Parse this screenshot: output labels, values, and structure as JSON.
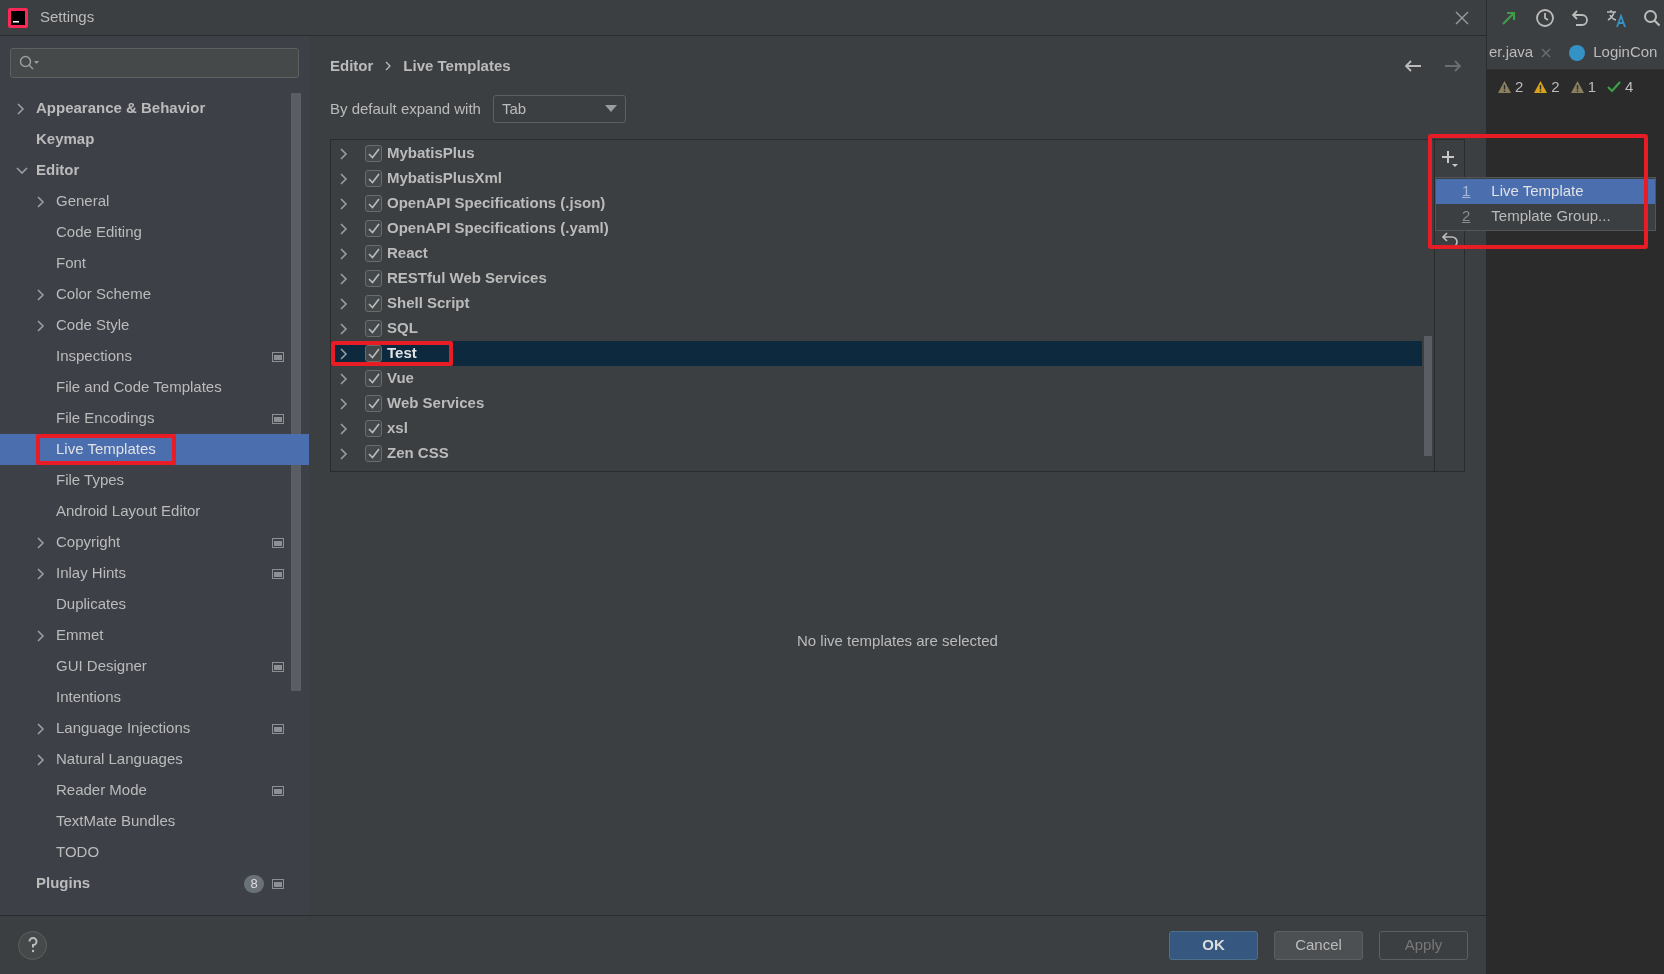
{
  "window": {
    "title": "Settings"
  },
  "sidebar": {
    "items": [
      {
        "label": "Appearance & Behavior",
        "expandable": true,
        "expanded": false,
        "selected": false,
        "highlighted": false,
        "project_level": false
      },
      {
        "label": "Keymap",
        "expandable": false,
        "selected": false,
        "highlighted": false,
        "project_level": false
      },
      {
        "label": "Editor",
        "expandable": true,
        "expanded": true,
        "selected": false,
        "highlighted": false,
        "project_level": false,
        "children": [
          {
            "label": "General",
            "expandable": true,
            "expanded": false,
            "selected": false,
            "highlighted": false,
            "project_level": false
          },
          {
            "label": "Code Editing",
            "expandable": false,
            "selected": false,
            "highlighted": false,
            "project_level": false
          },
          {
            "label": "Font",
            "expandable": false,
            "selected": false,
            "highlighted": false,
            "project_level": false
          },
          {
            "label": "Color Scheme",
            "expandable": true,
            "expanded": false,
            "selected": false,
            "highlighted": false,
            "project_level": false
          },
          {
            "label": "Code Style",
            "expandable": true,
            "expanded": false,
            "selected": false,
            "highlighted": false,
            "project_level": false
          },
          {
            "label": "Inspections",
            "expandable": false,
            "selected": false,
            "highlighted": false,
            "project_level": true
          },
          {
            "label": "File and Code Templates",
            "expandable": false,
            "selected": false,
            "highlighted": false,
            "project_level": false
          },
          {
            "label": "File Encodings",
            "expandable": false,
            "selected": false,
            "highlighted": false,
            "project_level": true
          },
          {
            "label": "Live Templates",
            "expandable": false,
            "selected": true,
            "highlighted": true,
            "project_level": false
          },
          {
            "label": "File Types",
            "expandable": false,
            "selected": false,
            "highlighted": false,
            "project_level": false
          },
          {
            "label": "Android Layout Editor",
            "expandable": false,
            "selected": false,
            "highlighted": false,
            "project_level": false
          },
          {
            "label": "Copyright",
            "expandable": true,
            "expanded": false,
            "selected": false,
            "highlighted": false,
            "project_level": true
          },
          {
            "label": "Inlay Hints",
            "expandable": true,
            "expanded": false,
            "selected": false,
            "highlighted": false,
            "project_level": true
          },
          {
            "label": "Duplicates",
            "expandable": false,
            "selected": false,
            "highlighted": false,
            "project_level": false
          },
          {
            "label": "Emmet",
            "expandable": true,
            "expanded": false,
            "selected": false,
            "highlighted": false,
            "project_level": false
          },
          {
            "label": "GUI Designer",
            "expandable": false,
            "selected": false,
            "highlighted": false,
            "project_level": true
          },
          {
            "label": "Intentions",
            "expandable": false,
            "selected": false,
            "highlighted": false,
            "project_level": false
          },
          {
            "label": "Language Injections",
            "expandable": true,
            "expanded": false,
            "selected": false,
            "highlighted": false,
            "project_level": true
          },
          {
            "label": "Natural Languages",
            "expandable": true,
            "expanded": false,
            "selected": false,
            "highlighted": false,
            "project_level": false
          },
          {
            "label": "Reader Mode",
            "expandable": false,
            "selected": false,
            "highlighted": false,
            "project_level": true
          },
          {
            "label": "TextMate Bundles",
            "expandable": false,
            "selected": false,
            "highlighted": false,
            "project_level": false
          },
          {
            "label": "TODO",
            "expandable": false,
            "selected": false,
            "highlighted": false,
            "project_level": false
          }
        ]
      },
      {
        "label": "Plugins",
        "expandable": false,
        "selected": false,
        "highlighted": false,
        "badge": "8",
        "project_level": true
      }
    ]
  },
  "breadcrumb": [
    "Editor",
    "Live Templates"
  ],
  "expand_with": {
    "label": "By default expand with",
    "value": "Tab"
  },
  "template_groups": [
    {
      "label": "MybatisPlus",
      "checked": true,
      "selected": false,
      "highlighted": false
    },
    {
      "label": "MybatisPlusXml",
      "checked": true,
      "selected": false,
      "highlighted": false
    },
    {
      "label": "OpenAPI Specifications (.json)",
      "checked": true,
      "selected": false,
      "highlighted": false
    },
    {
      "label": "OpenAPI Specifications (.yaml)",
      "checked": true,
      "selected": false,
      "highlighted": false
    },
    {
      "label": "React",
      "checked": true,
      "selected": false,
      "highlighted": false
    },
    {
      "label": "RESTful Web Services",
      "checked": true,
      "selected": false,
      "highlighted": false
    },
    {
      "label": "Shell Script",
      "checked": true,
      "selected": false,
      "highlighted": false
    },
    {
      "label": "SQL",
      "checked": true,
      "selected": false,
      "highlighted": false
    },
    {
      "label": "Test",
      "checked": true,
      "selected": true,
      "highlighted": true
    },
    {
      "label": "Vue",
      "checked": true,
      "selected": false,
      "highlighted": false
    },
    {
      "label": "Web Services",
      "checked": true,
      "selected": false,
      "highlighted": false
    },
    {
      "label": "xsl",
      "checked": true,
      "selected": false,
      "highlighted": false
    },
    {
      "label": "Zen CSS",
      "checked": true,
      "selected": false,
      "highlighted": false
    }
  ],
  "add_menu": {
    "highlighted": true,
    "items": [
      {
        "mnemonic": "1",
        "label": "Live Template",
        "selected": true
      },
      {
        "mnemonic": "2",
        "label": "Template Group...",
        "selected": false
      }
    ]
  },
  "empty_message": "No live templates are selected",
  "buttons": [
    {
      "label": "OK",
      "kind": "default"
    },
    {
      "label": "Cancel",
      "kind": "normal"
    },
    {
      "label": "Apply",
      "kind": "disabled"
    }
  ],
  "background_ide": {
    "tabs": [
      {
        "label": "er.java",
        "closable": true
      },
      {
        "label": "LoginCon",
        "closable": false
      }
    ],
    "inspections": [
      {
        "count": "2",
        "color": "#8a8060"
      },
      {
        "count": "2",
        "color": "#d9a21b"
      },
      {
        "count": "1",
        "color": "#8a8060"
      },
      {
        "count": "4",
        "color": "#3f9d49"
      }
    ]
  }
}
